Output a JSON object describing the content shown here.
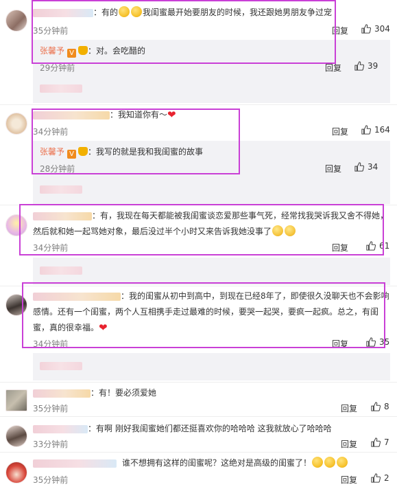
{
  "comments": [
    {
      "text": "：有的",
      "text_after_emoji": "我闺蜜最开始要朋友的时候，我还跟她男朋友争过宠",
      "time": "35分钟前",
      "reply": "回复",
      "likes": "304",
      "sub": {
        "author": "张馨予",
        "text": "：对。会吃醋的",
        "time": "29分钟前",
        "reply": "回复",
        "likes": "39"
      }
    },
    {
      "text": "：我知道你有～",
      "time": "34分钟前",
      "reply": "回复",
      "likes": "164",
      "sub": {
        "author": "张馨予",
        "text": "：我写的就是我和我闺蜜的故事",
        "time": "28分钟前",
        "reply": "回复",
        "likes": "34"
      }
    },
    {
      "line1": "：有，我现在每天都能被我闺蜜谈恋爱那些事气死，经常找我哭诉我又舍不得她，",
      "line2": "然后就和她一起骂她对象，最后没过半个小时又来告诉我她没事了",
      "time": "34分钟前",
      "reply": "回复",
      "likes": "61"
    },
    {
      "line1": "：我的闺蜜从初中到高中，到现在已经8年了，即使很久没聊天也不会影响",
      "line2": "感情。还有一个闺蜜，两个人互相携手走过最难的时候，要哭一起哭，要疯一起疯。总之，有闺",
      "line3": "蜜，真的很幸福。",
      "time": "34分钟前",
      "reply": "回复",
      "likes": "35"
    },
    {
      "text": "：有！要必须爱她",
      "time": "35分钟前",
      "reply": "回复",
      "likes": "8"
    },
    {
      "text": "：有啊  刚好我闺蜜她们都还挺喜欢你的哈哈哈  这我就放心了哈哈哈",
      "time": "33分钟前",
      "reply": "回复",
      "likes": "7"
    },
    {
      "text": "谁不想拥有这样的闺蜜呢？这绝对是高级的闺蜜了！",
      "time": "35分钟前",
      "reply": "回复",
      "likes": "2"
    }
  ],
  "colors": {
    "highlight": "#c93fd6",
    "author": "#eb7350",
    "meta": "#808080",
    "heart": "#e8232f"
  },
  "icons": {
    "like": "thumbs-up-icon",
    "verified": "verified-v-icon",
    "crown": "crown-badge-icon"
  }
}
